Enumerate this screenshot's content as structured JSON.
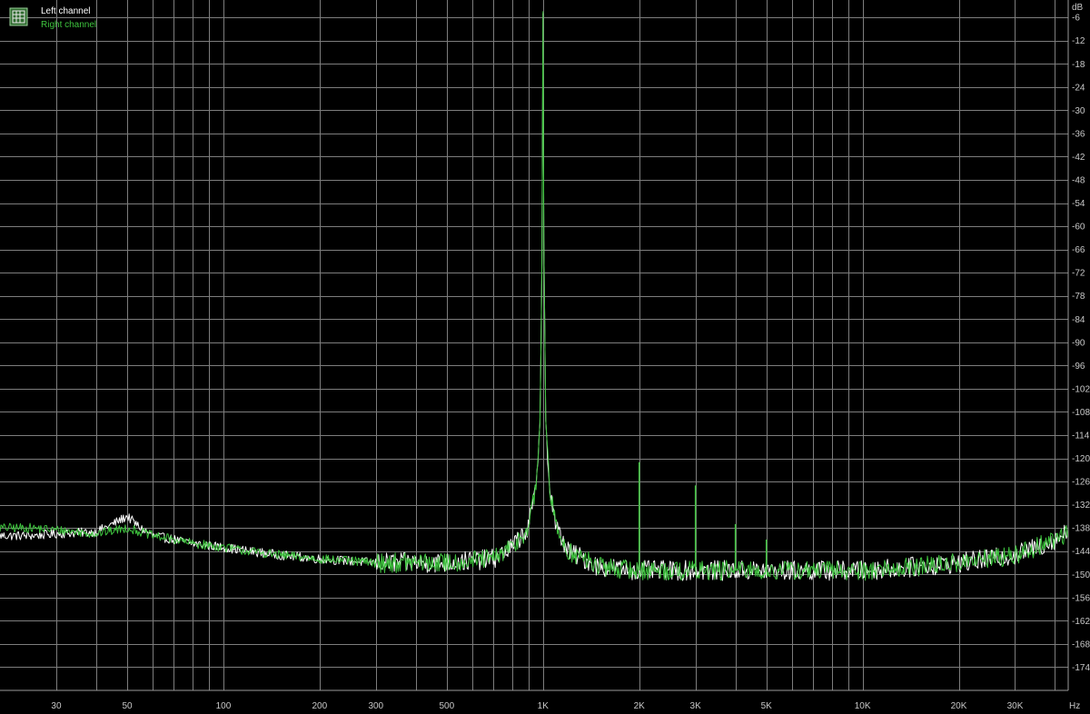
{
  "chart_data": {
    "type": "line",
    "xlabel": "",
    "ylabel": "",
    "x_unit": "Hz",
    "y_unit": "dB",
    "x_scale": "log",
    "xlim": [
      20,
      44000
    ],
    "ylim": [
      -180,
      -1.5
    ],
    "grid": true,
    "legend_position": "top-left",
    "x_tick_labels": [
      {
        "value": 30,
        "label": "30"
      },
      {
        "value": 50,
        "label": "50"
      },
      {
        "value": 100,
        "label": "100"
      },
      {
        "value": 200,
        "label": "200"
      },
      {
        "value": 300,
        "label": "300"
      },
      {
        "value": 500,
        "label": "500"
      },
      {
        "value": 1000,
        "label": "1K"
      },
      {
        "value": 2000,
        "label": "2K"
      },
      {
        "value": 3000,
        "label": "3K"
      },
      {
        "value": 5000,
        "label": "5K"
      },
      {
        "value": 10000,
        "label": "10K"
      },
      {
        "value": 20000,
        "label": "20K"
      },
      {
        "value": 30000,
        "label": "30K"
      }
    ],
    "y_ticks": [
      -6,
      -12,
      -18,
      -24,
      -30,
      -36,
      -42,
      -48,
      -54,
      -60,
      -66,
      -72,
      -78,
      -84,
      -90,
      -96,
      -102,
      -108,
      -114,
      -120,
      -126,
      -132,
      -138,
      -144,
      -150,
      -156,
      -162,
      -168,
      -174
    ],
    "series": [
      {
        "name": "Left channel",
        "color": "#ffffff",
        "points": [
          [
            20,
            -140
          ],
          [
            25,
            -140
          ],
          [
            30,
            -139.5
          ],
          [
            40,
            -139
          ],
          [
            45,
            -137
          ],
          [
            50,
            -135
          ],
          [
            55,
            -138
          ],
          [
            60,
            -140
          ],
          [
            70,
            -141
          ],
          [
            80,
            -142
          ],
          [
            100,
            -143
          ],
          [
            120,
            -144
          ],
          [
            150,
            -145
          ],
          [
            200,
            -146
          ],
          [
            300,
            -147
          ],
          [
            500,
            -147
          ],
          [
            700,
            -146
          ],
          [
            800,
            -143
          ],
          [
            900,
            -138
          ],
          [
            950,
            -128
          ],
          [
            980,
            -110
          ],
          [
            995,
            -60
          ],
          [
            1000,
            -5
          ],
          [
            1005,
            -60
          ],
          [
            1020,
            -110
          ],
          [
            1050,
            -128
          ],
          [
            1100,
            -138
          ],
          [
            1200,
            -144
          ],
          [
            1500,
            -148
          ],
          [
            2000,
            -149
          ],
          [
            3000,
            -149
          ],
          [
            4000,
            -149
          ],
          [
            5000,
            -149
          ],
          [
            7000,
            -149
          ],
          [
            10000,
            -149
          ],
          [
            15000,
            -148
          ],
          [
            20000,
            -147
          ],
          [
            25000,
            -146
          ],
          [
            30000,
            -145
          ],
          [
            35000,
            -143
          ],
          [
            40000,
            -141
          ],
          [
            44000,
            -139
          ]
        ]
      },
      {
        "name": "Right channel",
        "color": "#3ec43e",
        "points": [
          [
            20,
            -138
          ],
          [
            25,
            -138
          ],
          [
            30,
            -138.5
          ],
          [
            40,
            -139.5
          ],
          [
            50,
            -138
          ],
          [
            55,
            -139
          ],
          [
            60,
            -140
          ],
          [
            70,
            -141
          ],
          [
            80,
            -142
          ],
          [
            100,
            -143
          ],
          [
            120,
            -144
          ],
          [
            150,
            -145
          ],
          [
            200,
            -146
          ],
          [
            300,
            -147
          ],
          [
            500,
            -147
          ],
          [
            700,
            -146
          ],
          [
            800,
            -143
          ],
          [
            900,
            -138
          ],
          [
            950,
            -128
          ],
          [
            980,
            -110
          ],
          [
            995,
            -60
          ],
          [
            1000,
            -4.5
          ],
          [
            1005,
            -60
          ],
          [
            1020,
            -110
          ],
          [
            1050,
            -128
          ],
          [
            1100,
            -138
          ],
          [
            1200,
            -144
          ],
          [
            1500,
            -148
          ],
          [
            2000,
            -149
          ],
          [
            3000,
            -149
          ],
          [
            4000,
            -149
          ],
          [
            5000,
            -149
          ],
          [
            7000,
            -149
          ],
          [
            10000,
            -149
          ],
          [
            15000,
            -148
          ],
          [
            20000,
            -147
          ],
          [
            25000,
            -146
          ],
          [
            30000,
            -145
          ],
          [
            35000,
            -143
          ],
          [
            40000,
            -141
          ],
          [
            44000,
            -139
          ]
        ],
        "harmonics": [
          [
            2000,
            -121
          ],
          [
            3000,
            -127
          ],
          [
            4000,
            -137
          ],
          [
            5000,
            -141
          ]
        ]
      }
    ]
  }
}
